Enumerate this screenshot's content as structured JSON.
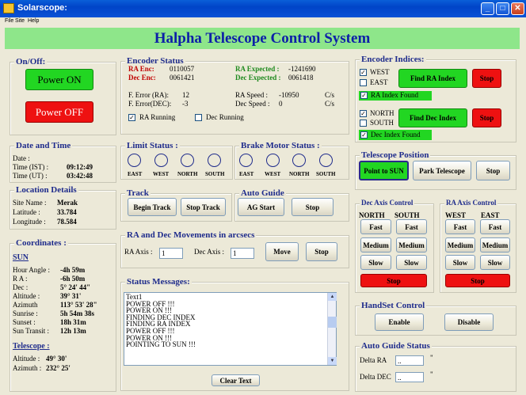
{
  "window": {
    "title": "Solarscope:"
  },
  "menu": [
    "File",
    "Site",
    "Help"
  ],
  "banner": "Halpha Telescope Control System",
  "onoff": {
    "title": "On/Off:",
    "power_on": "Power ON",
    "power_off": "Power OFF"
  },
  "datetime": {
    "title": "Date and Time",
    "date_label": "Date :",
    "date_value": "",
    "ist_label": "Time (IST) :",
    "ist_value": "09:12:49",
    "ut_label": "Time (UT) :",
    "ut_value": "03:42:48"
  },
  "location": {
    "title": "Location Details",
    "site_label": "Site Name :",
    "site_value": "Merak",
    "lat_label": "Latitude :",
    "lat_value": "33.784",
    "lon_label": "Longitude :",
    "lon_value": "78.584"
  },
  "coords": {
    "title": "Coordinates :",
    "object": "SUN",
    "rows": [
      {
        "label": "Hour Angle :",
        "value": "-4h 59m"
      },
      {
        "label": "R A :",
        "value": "-6h 50m"
      },
      {
        "label": "Dec :",
        "value": "5° 24' 44\""
      },
      {
        "label": "Altitude :",
        "value": "39° 31'"
      },
      {
        "label": "Azimuth",
        "value": "113° 53' 28\""
      },
      {
        "label": "Sunrise :",
        "value": "5h 54m 38s"
      },
      {
        "label": "Sunset :",
        "value": "18h 31m"
      },
      {
        "label": "Sun Transit :",
        "value": "12h 13m"
      }
    ],
    "telescope_title": "Telescope :",
    "tel_alt_label": "Altitude :",
    "tel_alt_value": "49° 30'",
    "tel_az_label": "Azimuth :",
    "tel_az_value": "232° 25'"
  },
  "encoder": {
    "title": "Encoder Status",
    "ra_enc_label": "RA Enc:",
    "ra_enc_value": "0110057",
    "dec_enc_label": "Dec Enc:",
    "dec_enc_value": "0061421",
    "ra_exp_label": "RA Expected :",
    "ra_exp_value": "-1241690",
    "dec_exp_label": "Dec Expected :",
    "dec_exp_value": "0061418",
    "ferr_label": "F. Error (RA):",
    "ferr_value": "12",
    "ferr_dec_label": "F. Error(DEC):",
    "ferr_dec_value": "-3",
    "ra_speed_label": "RA Speed :",
    "ra_speed_value": "-10950",
    "dec_speed_label": "Dec Speed :",
    "dec_speed_value": "0",
    "unit": "C/s",
    "ra_running": "RA Running",
    "dec_running": "Dec Running"
  },
  "limit": {
    "title": "Limit Status :",
    "labels": [
      "EAST",
      "WEST",
      "NORTH",
      "SOUTH"
    ]
  },
  "brake": {
    "title": "Brake Motor Status :",
    "labels": [
      "EAST",
      "WEST",
      "NORTH",
      "SOUTH"
    ]
  },
  "track": {
    "title": "Track",
    "begin": "Begin Track",
    "stop": "Stop Track"
  },
  "autoguide": {
    "title": "Auto Guide",
    "start": "AG Start",
    "stop": "Stop"
  },
  "movements": {
    "title": "RA and Dec Movements in arcsecs",
    "ra_label": "RA Axis :",
    "ra_value": "1",
    "dec_label": "Dec Axis :",
    "dec_value": "1",
    "move": "Move",
    "stop": "Stop"
  },
  "status": {
    "title": "Status Messages:",
    "lines": [
      "Text1",
      "POWER OFF !!!",
      "POWER ON !!!",
      "FINDING DEC INDEX",
      "FINDING RA INDEX",
      "POWER OFF !!!",
      "POWER ON !!!",
      "POINTING TO SUN !!!"
    ],
    "clear": "Clear Text"
  },
  "indices": {
    "title": "Encoder Indices:",
    "west": "WEST",
    "east": "EAST",
    "find_ra": "Find RA Index",
    "stop": "Stop",
    "ra_found": "RA Index Found",
    "north": "NORTH",
    "south": "SOUTH",
    "find_dec": "Find Dec Index",
    "dec_found": "Dec Index Found"
  },
  "position": {
    "title": "Telescope Position",
    "point_sun": "Point to SUN",
    "park": "Park Telescope",
    "stop": "Stop"
  },
  "dec_axis": {
    "title": "Dec Axis Control",
    "north": "NORTH",
    "south": "SOUTH",
    "fast": "Fast",
    "medium": "Medium",
    "slow": "Slow",
    "stop": "Stop"
  },
  "ra_axis": {
    "title": "RA Axis Control",
    "west": "WEST",
    "east": "EAST",
    "fast": "Fast",
    "medium": "Medium",
    "slow": "Slow",
    "stop": "Stop"
  },
  "handset": {
    "title": "HandSet Control",
    "enable": "Enable",
    "disable": "Disable"
  },
  "agstatus": {
    "title": "Auto Guide Status",
    "delta_ra": "Delta RA",
    "delta_dec": "Delta DEC",
    "ra_value": "..",
    "dec_value": "..",
    "unit": "\""
  },
  "colors": {
    "banner_bg": "#8ee68a",
    "banner_text": "#0d1fa8",
    "accent_green": "#22d622",
    "accent_red": "#ee1111",
    "group_title": "#1f2c8c"
  }
}
